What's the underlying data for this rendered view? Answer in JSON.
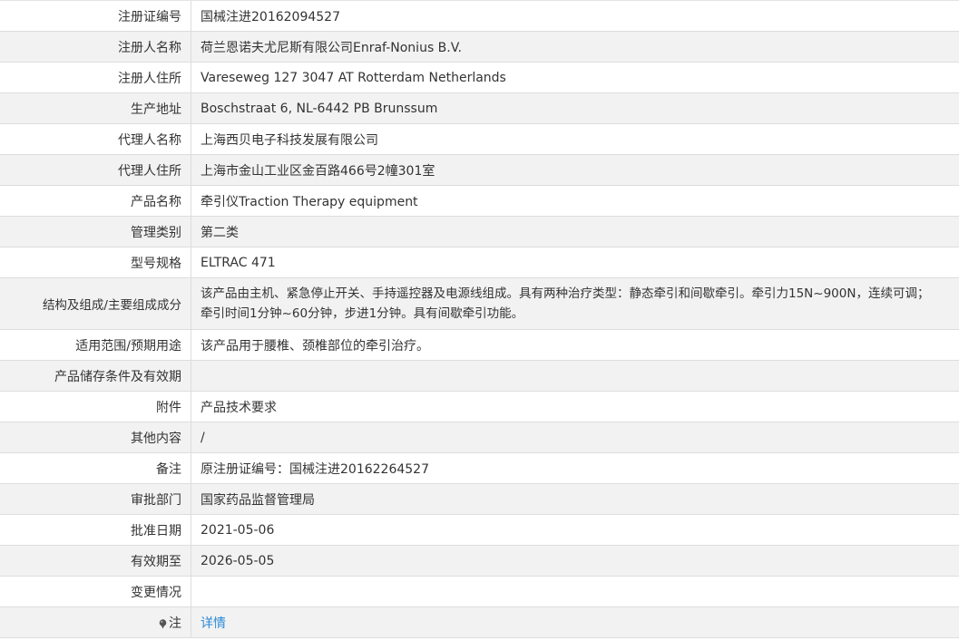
{
  "rows": [
    {
      "label": "注册证编号",
      "value": "国械注进20162094527"
    },
    {
      "label": "注册人名称",
      "value": "荷兰恩诺夫尤尼斯有限公司Enraf-Nonius B.V."
    },
    {
      "label": "注册人住所",
      "value": "Vareseweg 127 3047 AT Rotterdam Netherlands"
    },
    {
      "label": "生产地址",
      "value": "Boschstraat 6, NL-6442 PB Brunssum"
    },
    {
      "label": "代理人名称",
      "value": "上海西贝电子科技发展有限公司"
    },
    {
      "label": "代理人住所",
      "value": "上海市金山工业区金百路466号2幢301室"
    },
    {
      "label": "产品名称",
      "value": "牵引仪Traction Therapy equipment"
    },
    {
      "label": "管理类别",
      "value": "第二类"
    },
    {
      "label": "型号规格",
      "value": "ELTRAC 471"
    },
    {
      "label": "结构及组成/主要组成成分",
      "value": "该产品由主机、紧急停止开关、手持遥控器及电源线组成。具有两种治疗类型：静态牵引和间歇牵引。牵引力15N~900N，连续可调；牵引时间1分钟~60分钟，步进1分钟。具有间歇牵引功能。"
    },
    {
      "label": "适用范围/预期用途",
      "value": "该产品用于腰椎、颈椎部位的牵引治疗。"
    },
    {
      "label": "产品储存条件及有效期",
      "value": ""
    },
    {
      "label": "附件",
      "value": "产品技术要求"
    },
    {
      "label": "其他内容",
      "value": "/"
    },
    {
      "label": "备注",
      "value": "原注册证编号：国械注进20162264527"
    },
    {
      "label": "审批部门",
      "value": "国家药品监督管理局"
    },
    {
      "label": "批准日期",
      "value": "2021-05-06"
    },
    {
      "label": "有效期至",
      "value": "2026-05-05"
    },
    {
      "label": "变更情况",
      "value": ""
    }
  ],
  "note": {
    "label": "注",
    "link_text": "详情",
    "icon": "pin-icon"
  }
}
